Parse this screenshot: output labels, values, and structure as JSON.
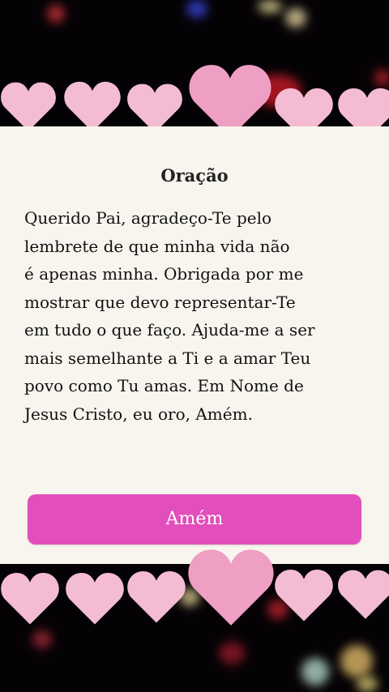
{
  "prayer": {
    "title": "Oração",
    "body": "Querido Pai, agradeço-Te pelo\nlembrete de que minha vida não\né apenas minha. Obrigada por me\nmostrar que devo representar-Te\nem tudo o que faço. Ajuda-me a ser\nmais semelhante a Ti e a amar Teu\npovo como Tu amas. Em Nome de\nJesus Cristo, eu oro, Amém.",
    "button_label": "Amém"
  },
  "background": {
    "pattern": "pixel-heart-icon",
    "heart_color": "#f4bcd3",
    "heart_color_large": "#ee9fc3"
  },
  "colors": {
    "card": "#f8f5ee",
    "button": "#e24ebc"
  }
}
